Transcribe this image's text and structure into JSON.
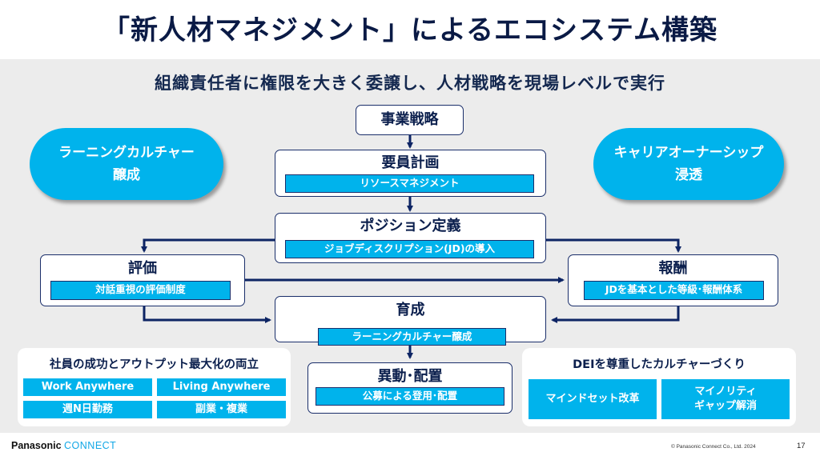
{
  "title": "「新人材マネジメント」によるエコシステム構築",
  "subtitle": "組織責任者に権限を大きく委譲し、人材戦略を現場レベルで実行",
  "pills": {
    "left": {
      "line1": "ラーニングカルチャー",
      "line2": "醸成"
    },
    "right": {
      "line1": "キャリアオーナーシップ",
      "line2": "浸透"
    }
  },
  "flow": {
    "business_strategy": {
      "title": "事業戦略"
    },
    "staffing_plan": {
      "title": "要員計画",
      "sub": "リソースマネジメント"
    },
    "position_definition": {
      "title": "ポジション定義",
      "sub": "ジョブディスクリプション(JD)の導入"
    },
    "evaluation": {
      "title": "評価",
      "sub": "対話重視の評価制度"
    },
    "compensation": {
      "title": "報酬",
      "sub": "JDを基本とした等級･報酬体系"
    },
    "development": {
      "title": "育成",
      "sub": "ラーニングカルチャー醸成"
    },
    "placement": {
      "title": "異動･配置",
      "sub": "公募による登用･配置"
    }
  },
  "panels": {
    "left": {
      "heading": "社員の成功とアウトプット最大化の両立",
      "tiles": [
        "Work Anywhere",
        "Living Anywhere",
        "週N日勤務",
        "副業・複業"
      ]
    },
    "right": {
      "heading": "DEIを尊重したカルチャーづくり",
      "tiles": [
        "マインドセット改革",
        "マイノリティ",
        "ギャップ解消"
      ]
    }
  },
  "colors": {
    "accent": "#00b3ec",
    "navy": "#1a2e6a",
    "background": "#ececec"
  },
  "footer": {
    "brand": "Panasonic",
    "brand_sub": "CONNECT",
    "copyright": "© Panasonic Connect Co., Ltd. 2024",
    "page_number": "17"
  }
}
